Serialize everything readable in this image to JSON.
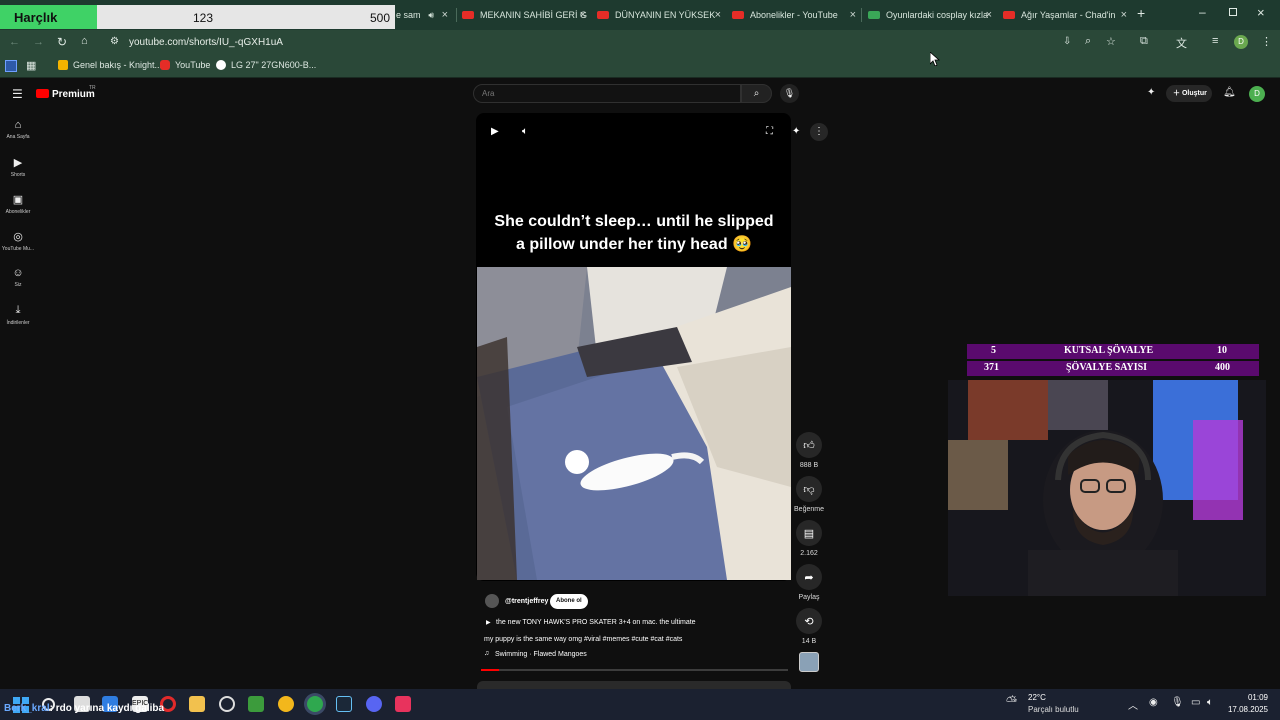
{
  "overlay_harclik": {
    "label": "Harçlık",
    "current": "123",
    "max": "500",
    "progress_fraction": 0.246
  },
  "tabs": [
    {
      "title": "e sam"
    },
    {
      "title": "MEKANIN SAHİBİ GERİ G"
    },
    {
      "title": "DÜNYANIN EN YÜKSEK"
    },
    {
      "title": "Abonelikler - YouTube"
    },
    {
      "title": "Oyunlardaki cosplay kızla"
    },
    {
      "title": "Ağır Yaşamlar - Chad'in"
    }
  ],
  "address_bar": {
    "url": "youtube.com/shorts/IU_-qGXH1uA"
  },
  "bookmarks": [
    {
      "label": "Genel bakış - Knight..."
    },
    {
      "label": "YouTube"
    },
    {
      "label": "LG 27\" 27GN600-B..."
    }
  ],
  "youtube": {
    "logo_text": "Premium",
    "logo_badge": "TR",
    "search_placeholder": "Ara",
    "create_label": "Oluştur",
    "avatar_letter": "D",
    "sidebar": [
      {
        "label": "Ana Sayfa",
        "icon": "home-icon"
      },
      {
        "label": "Shorts",
        "icon": "shorts-icon"
      },
      {
        "label": "Abonelikler",
        "icon": "subscriptions-icon"
      },
      {
        "label": "YouTube Mu...",
        "icon": "youtube-music-icon"
      },
      {
        "label": "Siz",
        "icon": "you-icon"
      },
      {
        "label": "İndirilenler",
        "icon": "download-icon"
      }
    ],
    "short": {
      "caption_line1": "She couldn’t sleep… until he slipped",
      "caption_line2": "a pillow under her tiny head 🥹",
      "channel": "@trentjeffrey",
      "subscribe_label": "Abone ol",
      "title_line": "the new TONY HAWK'S PRO SKATER 3+4 on mac. the ultimate",
      "description": "my puppy is the same way omg #viral #memes #cute #cat #cats",
      "music": "Swimming · Flawed Mangoes"
    },
    "actions": {
      "like_count": "888 B",
      "dislike_label": "Beğenme",
      "comment_count": "2.162",
      "share_label": "Paylaş",
      "remix_count": "14 B"
    }
  },
  "knight_overlay": {
    "row1": {
      "left": "5",
      "title": "KUTSAL ŞÖVALYE",
      "right": "10"
    },
    "row2": {
      "left": "371",
      "title": "ŞÖVALYE SAYISI",
      "right": "400"
    }
  },
  "taskbar": {
    "chat_user": "Berk_kral",
    "chat_message": ": rdo yarına kaydı galiba",
    "weather_temp": "22°C",
    "weather_desc": "Parçalı bulutlu",
    "time": "01:09",
    "date": "17.08.2025"
  },
  "colors": {
    "tab_bar": "#1e3a2f",
    "accent_red": "#ff0000",
    "knight_purple": "#5a0a6e",
    "harclik_green": "#3fd266"
  }
}
